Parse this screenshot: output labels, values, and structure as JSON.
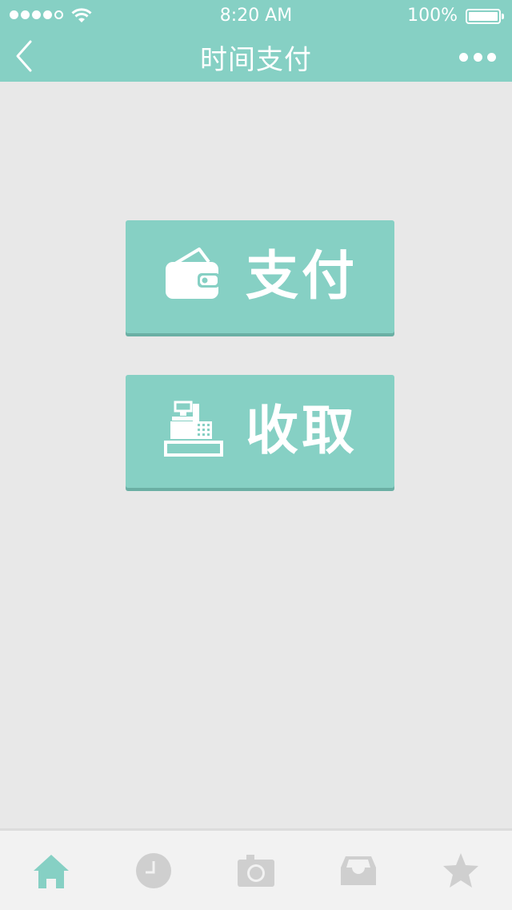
{
  "status_bar": {
    "time": "8:20 AM",
    "battery": "100%",
    "signal_bars_filled": 4,
    "signal_bars_total": 5
  },
  "nav": {
    "title": "时间支付",
    "back_icon": "chevron-left-icon",
    "more_icon": "more-dots-icon"
  },
  "actions": {
    "pay": {
      "label": "支付",
      "icon": "wallet-icon"
    },
    "receive": {
      "label": "收取",
      "icon": "cash-register-icon"
    }
  },
  "tabbar": {
    "items": [
      {
        "icon": "home-icon",
        "active": true
      },
      {
        "icon": "clock-icon",
        "active": false
      },
      {
        "icon": "camera-icon",
        "active": false
      },
      {
        "icon": "inbox-icon",
        "active": false
      },
      {
        "icon": "star-icon",
        "active": false
      }
    ]
  },
  "colors": {
    "accent": "#86d0c4",
    "background": "#e8e8e8",
    "tab_inactive": "#cfcfcf",
    "button_shadow": "#6aafa4"
  }
}
